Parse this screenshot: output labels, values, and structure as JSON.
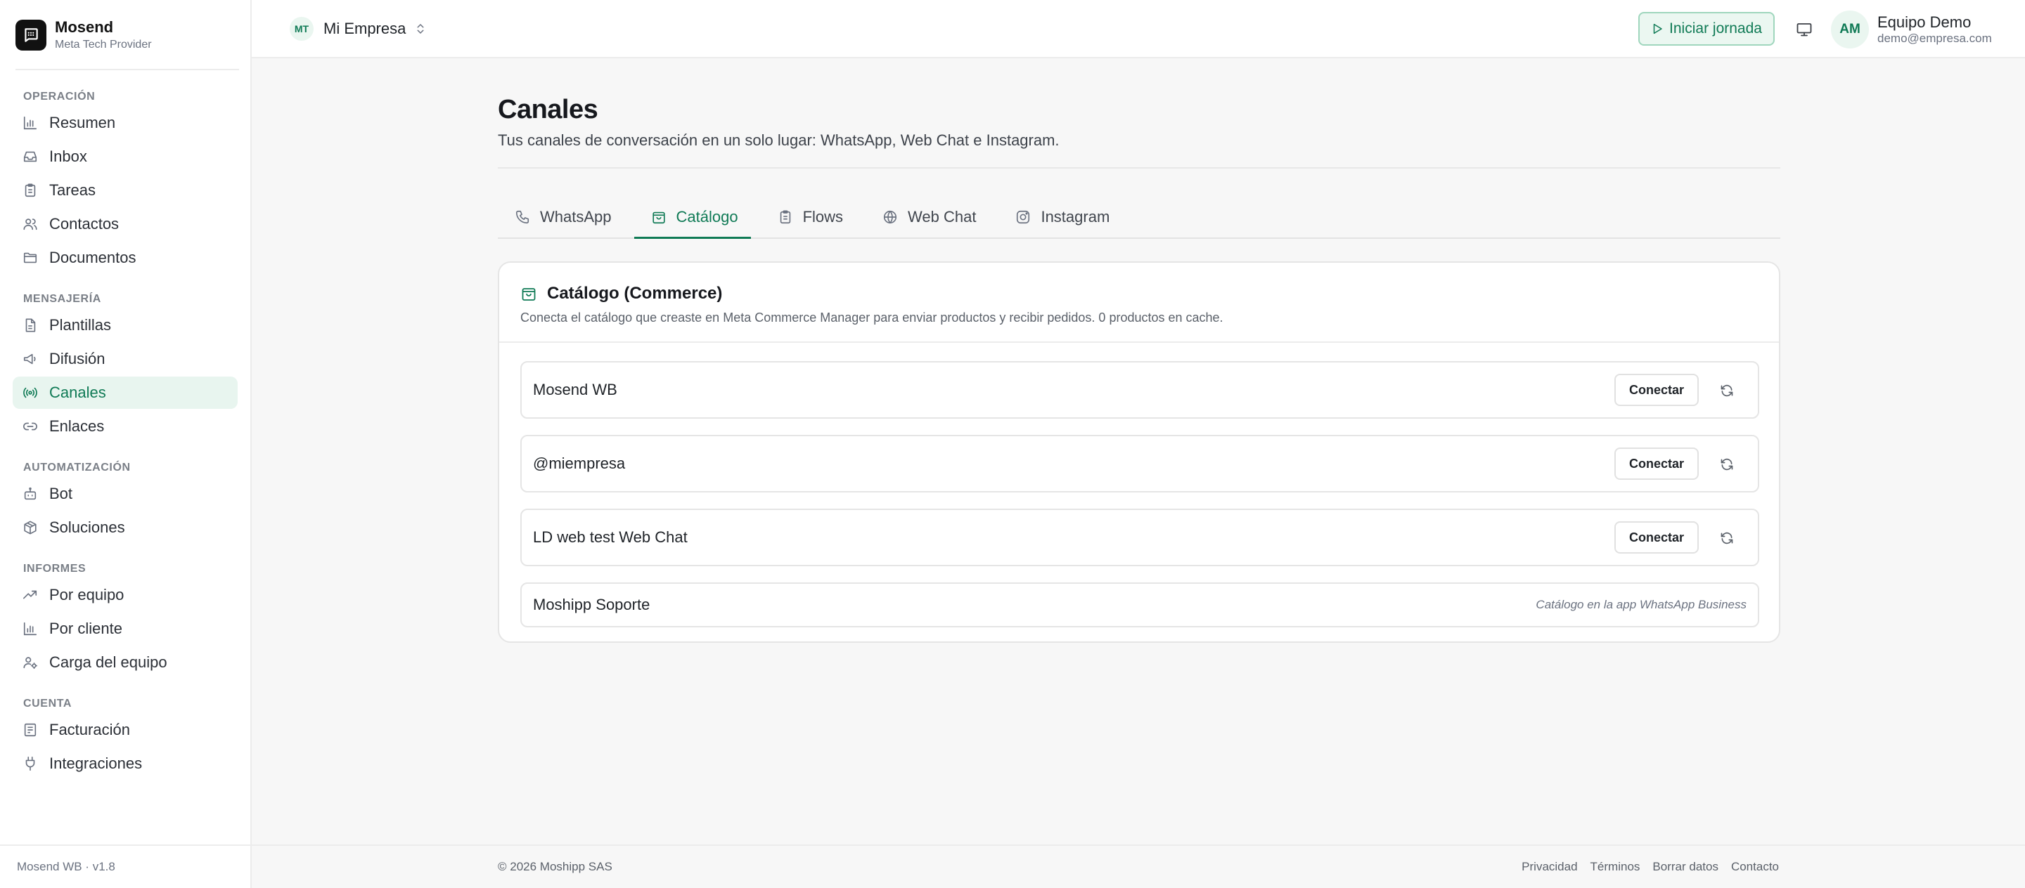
{
  "brand": {
    "name": "Mosend",
    "subtitle": "Meta Tech Provider"
  },
  "sidebar": {
    "sections": [
      {
        "title": "Operación",
        "items": [
          {
            "label": "Resumen",
            "icon": "bar-chart-icon"
          },
          {
            "label": "Inbox",
            "icon": "inbox-icon"
          },
          {
            "label": "Tareas",
            "icon": "clipboard-icon"
          },
          {
            "label": "Contactos",
            "icon": "users-icon"
          },
          {
            "label": "Documentos",
            "icon": "folder-icon"
          }
        ]
      },
      {
        "title": "Mensajería",
        "items": [
          {
            "label": "Plantillas",
            "icon": "file-text-icon"
          },
          {
            "label": "Difusión",
            "icon": "megaphone-icon"
          },
          {
            "label": "Canales",
            "icon": "broadcast-icon",
            "active": true
          },
          {
            "label": "Enlaces",
            "icon": "link-icon"
          }
        ]
      },
      {
        "title": "Automatización",
        "items": [
          {
            "label": "Bot",
            "icon": "bot-icon"
          },
          {
            "label": "Soluciones",
            "icon": "package-icon"
          }
        ]
      },
      {
        "title": "Informes",
        "items": [
          {
            "label": "Por equipo",
            "icon": "trending-up-icon"
          },
          {
            "label": "Por cliente",
            "icon": "bar-chart-icon"
          },
          {
            "label": "Carga del equipo",
            "icon": "user-cog-icon"
          }
        ]
      },
      {
        "title": "Cuenta",
        "items": [
          {
            "label": "Facturación",
            "icon": "receipt-icon"
          },
          {
            "label": "Integraciones",
            "icon": "plug-icon"
          }
        ]
      }
    ],
    "footer": "Mosend WB · v1.8"
  },
  "topbar": {
    "workspace_badge": "MT",
    "workspace_name": "Mi Empresa",
    "start_shift_label": "Iniciar jornada",
    "user_initials": "AM",
    "user_name": "Equipo Demo",
    "user_email": "demo@empresa.com"
  },
  "page": {
    "title": "Canales",
    "subtitle": "Tus canales de conversación en un solo lugar: WhatsApp, Web Chat e Instagram."
  },
  "tabs": [
    {
      "label": "WhatsApp",
      "icon": "phone-icon"
    },
    {
      "label": "Catálogo",
      "icon": "shopping-bag-icon",
      "active": true
    },
    {
      "label": "Flows",
      "icon": "clipboard-icon"
    },
    {
      "label": "Web Chat",
      "icon": "globe-icon"
    },
    {
      "label": "Instagram",
      "icon": "instagram-icon"
    }
  ],
  "catalog": {
    "title": "Catálogo (Commerce)",
    "description": "Conecta el catálogo que creaste en Meta Commerce Manager para enviar productos y recibir pedidos. 0 productos en cache.",
    "connect_label": "Conectar",
    "channels": [
      {
        "name": "Mosend WB",
        "connectable": true
      },
      {
        "name": "@miempresa",
        "connectable": true
      },
      {
        "name": "LD web test Web Chat",
        "connectable": true
      },
      {
        "name": "Moshipp Soporte",
        "connectable": false,
        "note": "Catálogo en la app WhatsApp Business"
      }
    ]
  },
  "footer": {
    "copyright": "© 2026 Moshipp SAS",
    "links": [
      "Privacidad",
      "Términos",
      "Borrar datos",
      "Contacto"
    ]
  },
  "colors": {
    "accent": "#0f7a55",
    "accent_bg": "#e8f5ef",
    "border": "#e5e5e5"
  }
}
